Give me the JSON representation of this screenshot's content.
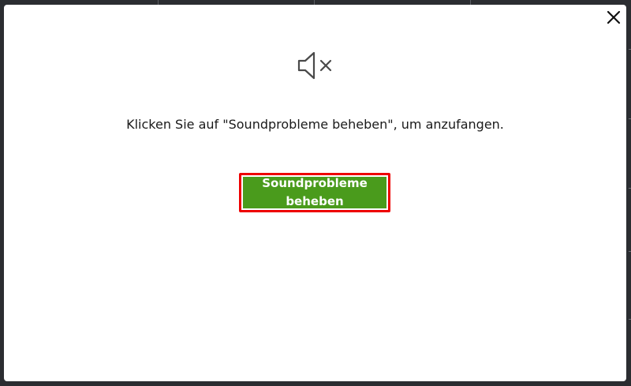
{
  "dialog": {
    "message": "Klicken Sie auf \"Soundprobleme beheben\", um anzufangen.",
    "action_label_line1": "Soundprobleme",
    "action_label_line2": "beheben",
    "close_icon": "close-icon",
    "status_icon": "speaker-muted-icon"
  },
  "colors": {
    "action_bg": "#4a9b1c",
    "highlight_border": "#ee0000",
    "backdrop": "#2b2d31"
  }
}
